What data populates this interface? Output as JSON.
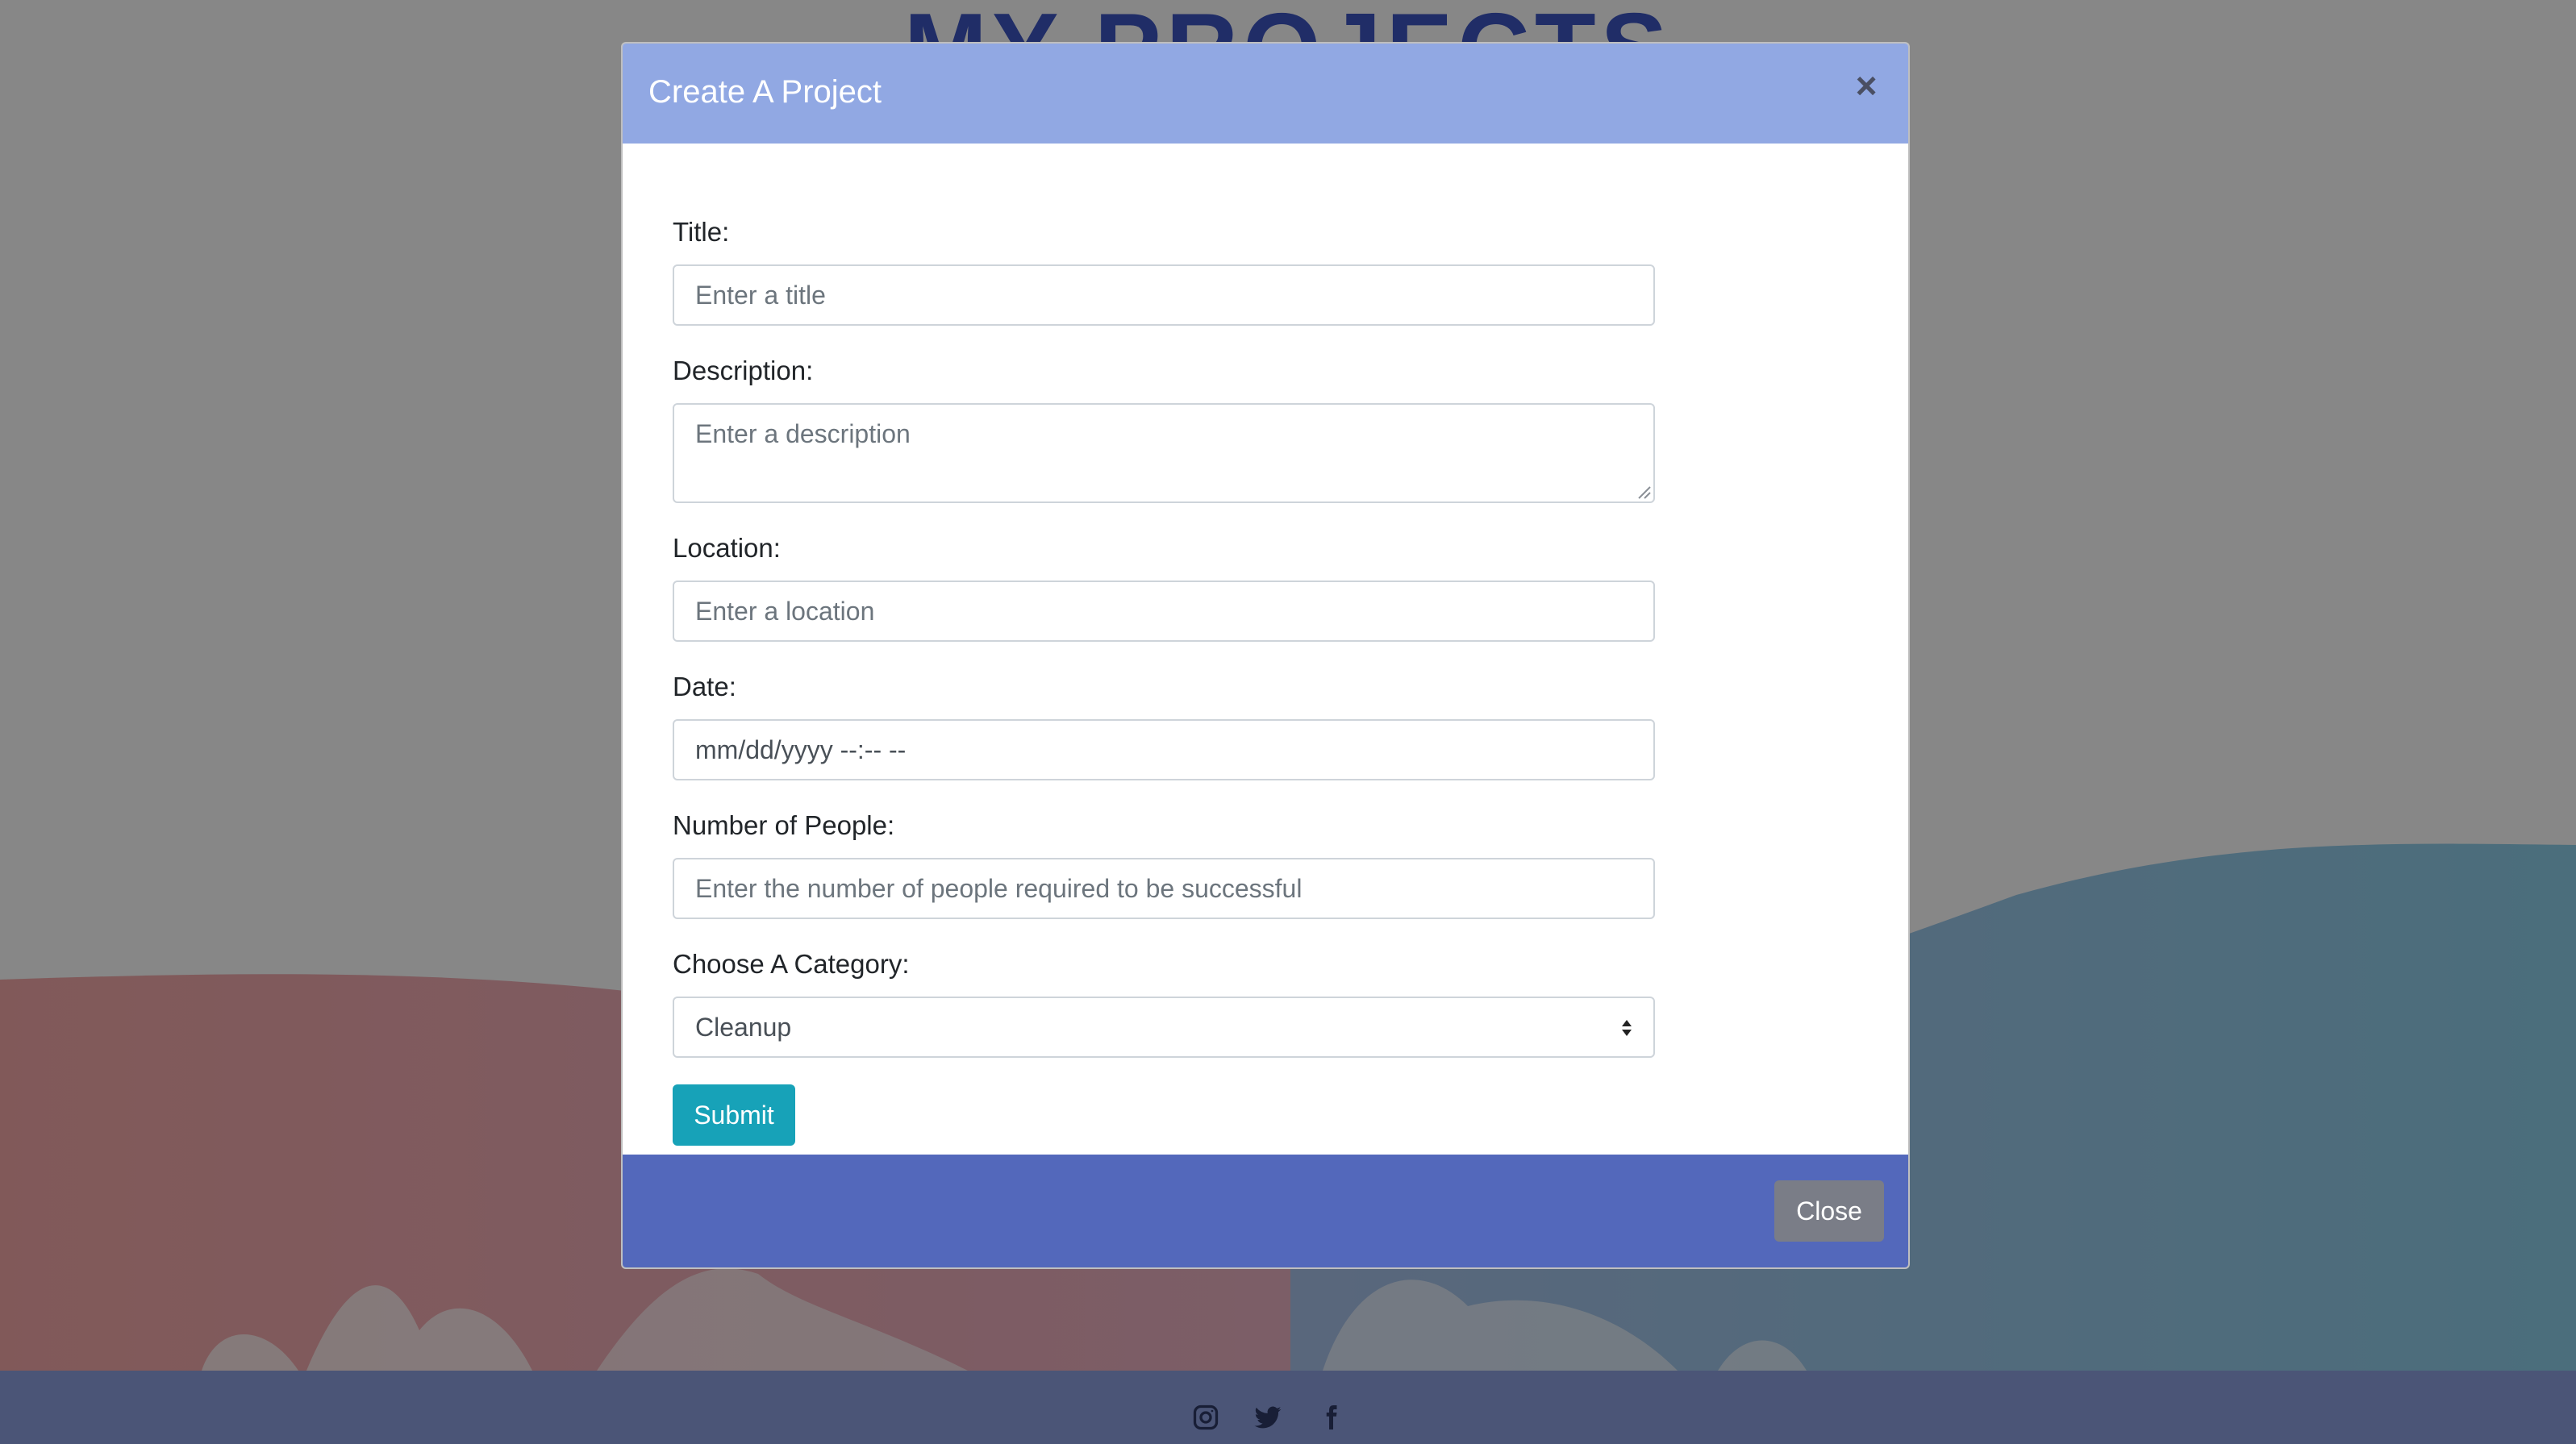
{
  "page": {
    "heading": "MY PROJECTS"
  },
  "footer": {
    "icons": [
      "instagram-icon",
      "twitter-icon",
      "facebook-icon"
    ]
  },
  "modal": {
    "title": "Create A Project",
    "close_symbol": "×",
    "fields": {
      "title": {
        "label": "Title:",
        "placeholder": "Enter a title",
        "value": ""
      },
      "description": {
        "label": "Description:",
        "placeholder": "Enter a description",
        "value": ""
      },
      "location": {
        "label": "Location:",
        "placeholder": "Enter a location",
        "value": ""
      },
      "date": {
        "label": "Date:",
        "display": "mm/dd/yyyy --:-- --"
      },
      "people": {
        "label": "Number of People:",
        "placeholder": "Enter the number of people required to be successful",
        "value": ""
      },
      "category": {
        "label": "Choose A Category:",
        "selected": "Cleanup"
      }
    },
    "submit_label": "Submit",
    "footer_close_label": "Close"
  },
  "colors": {
    "modal_header": "#91a8e3",
    "modal_footer": "#5368bb",
    "submit": "#17a2b8",
    "close_button": "#7a7d87",
    "heading": "#3d56c2"
  }
}
